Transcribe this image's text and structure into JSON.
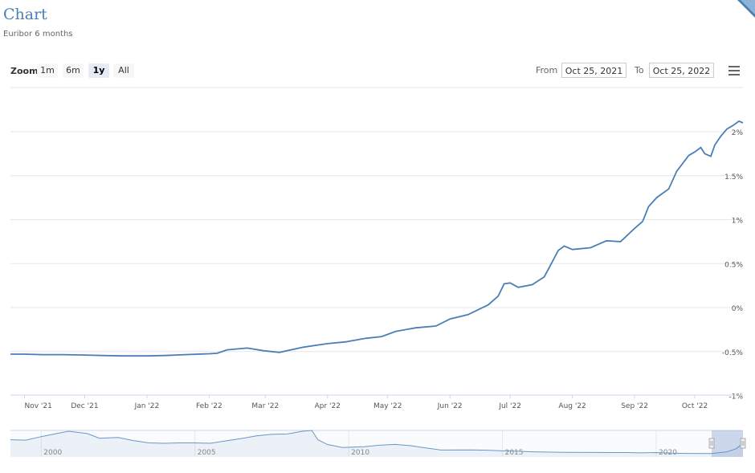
{
  "header": {
    "title": "Chart",
    "subtitle": "Euribor 6 months"
  },
  "range_selector": {
    "zoom_label": "Zoom",
    "buttons": [
      "1m",
      "6m",
      "1y",
      "All"
    ],
    "active": "1y",
    "from_label": "From",
    "from_value": "Oct 25, 2021",
    "to_label": "To",
    "to_value": "Oct 25, 2022"
  },
  "menu": {
    "icon": "hamburger-menu-icon"
  },
  "colors": {
    "line": "#4a7fb5",
    "accent": "#4a7fb5",
    "navigator_mask": "rgba(102,133,194,0.3)"
  },
  "chart_data": {
    "type": "line",
    "x_tick_labels": [
      "Nov '21",
      "Dec '21",
      "Jan '22",
      "Feb '22",
      "Mar '22",
      "Apr '22",
      "May '22",
      "Jun '22",
      "Jul '22",
      "Aug '22",
      "Sep '22",
      "Oct '22"
    ],
    "y_tick_labels": [
      "2%",
      "1.5%",
      "1%",
      "0.5%",
      "0%",
      "-0.5%",
      "-1%"
    ],
    "ylim": [
      -1,
      2.5
    ],
    "grid": true,
    "series": [
      {
        "values": [
          [
            "2021-10-25",
            -0.53
          ],
          [
            "2021-11-01",
            -0.53
          ],
          [
            "2021-11-10",
            -0.535
          ],
          [
            "2021-11-20",
            -0.535
          ],
          [
            "2021-12-01",
            -0.54
          ],
          [
            "2021-12-10",
            -0.545
          ],
          [
            "2021-12-20",
            -0.55
          ],
          [
            "2022-01-01",
            -0.55
          ],
          [
            "2022-01-10",
            -0.545
          ],
          [
            "2022-01-20",
            -0.535
          ],
          [
            "2022-02-01",
            -0.525
          ],
          [
            "2022-02-05",
            -0.52
          ],
          [
            "2022-02-10",
            -0.48
          ],
          [
            "2022-02-20",
            -0.46
          ],
          [
            "2022-02-28",
            -0.49
          ],
          [
            "2022-03-08",
            -0.51
          ],
          [
            "2022-03-20",
            -0.45
          ],
          [
            "2022-04-01",
            -0.41
          ],
          [
            "2022-04-10",
            -0.39
          ],
          [
            "2022-04-20",
            -0.35
          ],
          [
            "2022-04-28",
            -0.33
          ],
          [
            "2022-05-05",
            -0.27
          ],
          [
            "2022-05-15",
            -0.23
          ],
          [
            "2022-05-25",
            -0.21
          ],
          [
            "2022-06-01",
            -0.13
          ],
          [
            "2022-06-10",
            -0.08
          ],
          [
            "2022-06-20",
            0.03
          ],
          [
            "2022-06-25",
            0.13
          ],
          [
            "2022-06-28",
            0.27
          ],
          [
            "2022-07-01",
            0.28
          ],
          [
            "2022-07-05",
            0.23
          ],
          [
            "2022-07-12",
            0.26
          ],
          [
            "2022-07-18",
            0.35
          ],
          [
            "2022-07-22",
            0.52
          ],
          [
            "2022-07-25",
            0.65
          ],
          [
            "2022-07-28",
            0.7
          ],
          [
            "2022-08-01",
            0.66
          ],
          [
            "2022-08-10",
            0.68
          ],
          [
            "2022-08-18",
            0.76
          ],
          [
            "2022-08-25",
            0.75
          ],
          [
            "2022-09-01",
            0.9
          ],
          [
            "2022-09-05",
            0.98
          ],
          [
            "2022-09-08",
            1.15
          ],
          [
            "2022-09-12",
            1.25
          ],
          [
            "2022-09-18",
            1.35
          ],
          [
            "2022-09-22",
            1.55
          ],
          [
            "2022-09-28",
            1.73
          ],
          [
            "2022-10-01",
            1.77
          ],
          [
            "2022-10-04",
            1.82
          ],
          [
            "2022-10-06",
            1.75
          ],
          [
            "2022-10-09",
            1.72
          ],
          [
            "2022-10-11",
            1.85
          ],
          [
            "2022-10-14",
            1.95
          ],
          [
            "2022-10-17",
            2.03
          ],
          [
            "2022-10-20",
            2.07
          ],
          [
            "2022-10-23",
            2.12
          ],
          [
            "2022-10-25",
            2.1
          ]
        ]
      }
    ],
    "navigator": {
      "x_tick_labels": [
        "2000",
        "2005",
        "2010",
        "2015",
        "2020"
      ],
      "values": [
        [
          1999,
          3.0
        ],
        [
          1999.5,
          2.9
        ],
        [
          2000,
          3.8
        ],
        [
          2000.5,
          4.6
        ],
        [
          2000.9,
          5.2
        ],
        [
          2001.5,
          4.6
        ],
        [
          2001.9,
          3.4
        ],
        [
          2002.5,
          3.6
        ],
        [
          2003,
          2.8
        ],
        [
          2003.5,
          2.2
        ],
        [
          2004,
          2.1
        ],
        [
          2004.5,
          2.2
        ],
        [
          2005,
          2.2
        ],
        [
          2005.5,
          2.1
        ],
        [
          2006,
          2.7
        ],
        [
          2006.5,
          3.3
        ],
        [
          2007,
          4.0
        ],
        [
          2007.5,
          4.4
        ],
        [
          2008,
          4.5
        ],
        [
          2008.5,
          5.2
        ],
        [
          2008.8,
          5.4
        ],
        [
          2009,
          3.0
        ],
        [
          2009.3,
          1.8
        ],
        [
          2009.8,
          1.0
        ],
        [
          2010.5,
          1.2
        ],
        [
          2011,
          1.6
        ],
        [
          2011.5,
          1.8
        ],
        [
          2012,
          1.5
        ],
        [
          2012.5,
          0.9
        ],
        [
          2013,
          0.35
        ],
        [
          2014,
          0.4
        ],
        [
          2014.5,
          0.3
        ],
        [
          2015,
          0.15
        ],
        [
          2015.5,
          0.05
        ],
        [
          2016,
          -0.1
        ],
        [
          2017,
          -0.22
        ],
        [
          2018,
          -0.26
        ],
        [
          2019,
          -0.3
        ],
        [
          2019.5,
          -0.38
        ],
        [
          2020,
          -0.3
        ],
        [
          2020.5,
          -0.45
        ],
        [
          2021,
          -0.52
        ],
        [
          2021.8,
          -0.53
        ],
        [
          2022.3,
          -0.1
        ],
        [
          2022.6,
          0.7
        ],
        [
          2022.82,
          2.1
        ]
      ]
    }
  }
}
